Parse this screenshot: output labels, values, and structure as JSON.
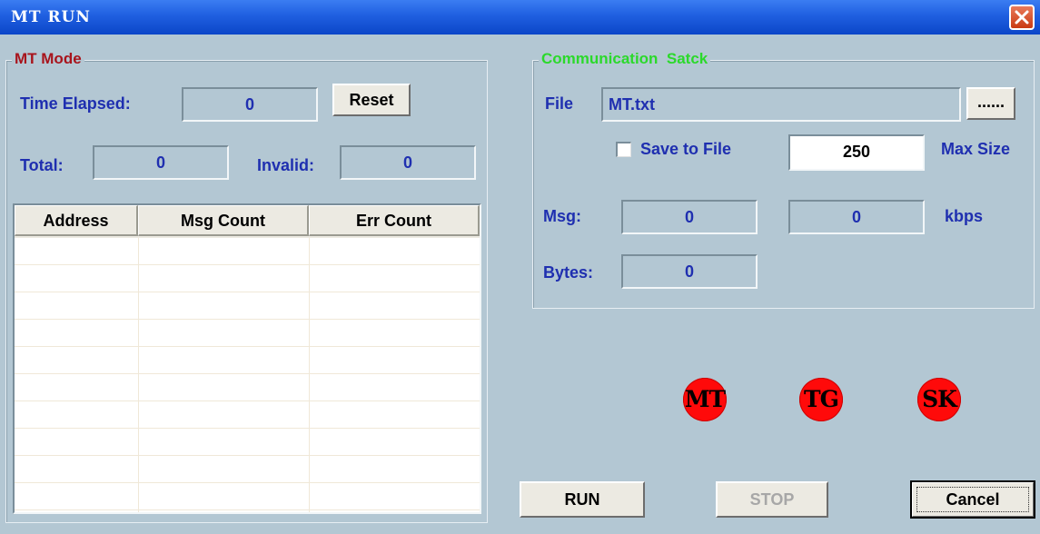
{
  "window": {
    "title": "MT RUN"
  },
  "mt_mode": {
    "legend": "MT Mode",
    "time_elapsed_label": "Time Elapsed:",
    "time_elapsed_value": "0",
    "reset_label": "Reset",
    "total_label": "Total:",
    "total_value": "0",
    "invalid_label": "Invalid:",
    "invalid_value": "0",
    "table": {
      "columns": [
        "Address",
        "Msg Count",
        "Err Count"
      ],
      "rows": []
    }
  },
  "comm_stack": {
    "legend": "Communication  Satck",
    "file_label": "File",
    "file_value": "MT.txt",
    "browse_label": "......",
    "save_to_file_label": "Save to File",
    "save_to_file_checked": false,
    "max_size_value": "250",
    "max_size_label": "Max Size",
    "msg_label": "Msg:",
    "msg_value": "0",
    "kbps_value": "0",
    "kbps_label": "kbps",
    "bytes_label": "Bytes:",
    "bytes_value": "0"
  },
  "indicators": [
    {
      "label": "MT",
      "color": "#ff0a0a"
    },
    {
      "label": "TG",
      "color": "#ff0a0a"
    },
    {
      "label": "SK",
      "color": "#ff0a0a"
    }
  ],
  "buttons": {
    "run": "RUN",
    "stop": "STOP",
    "cancel": "Cancel"
  },
  "colors": {
    "mt_mode_legend": "#a8141c",
    "comm_legend": "#2bd92b",
    "label_text": "#1f2fb0",
    "dialog_bg": "#b3c7d3"
  }
}
